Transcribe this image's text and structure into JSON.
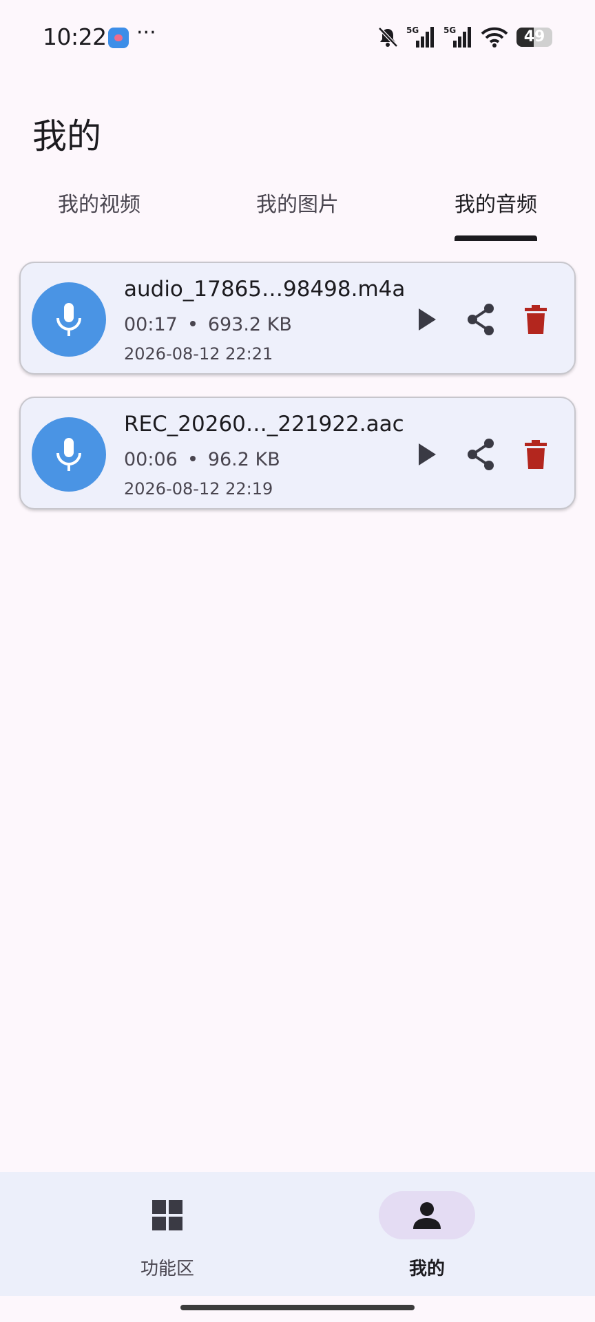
{
  "status_bar": {
    "time": "10:22",
    "dots": "···",
    "battery_level": "49",
    "icons": [
      "notifications-off-icon",
      "signal-5g-icon",
      "signal-5g-icon",
      "wifi-icon",
      "battery-icon"
    ]
  },
  "page": {
    "title": "我的"
  },
  "tabs": [
    {
      "label": "我的视频",
      "active": false
    },
    {
      "label": "我的图片",
      "active": false
    },
    {
      "label": "我的音频",
      "active": true
    }
  ],
  "audio_items": [
    {
      "name": "audio_17865…98498.m4a",
      "duration": "00:17",
      "size": "693.2 KB",
      "date": "2026-08-12 22:21"
    },
    {
      "name": "REC_20260…_221922.aac",
      "duration": "00:06",
      "size": "96.2 KB",
      "date": "2026-08-12 22:19"
    }
  ],
  "bottom_nav": [
    {
      "label": "功能区",
      "icon": "grid-icon",
      "selected": false
    },
    {
      "label": "我的",
      "icon": "person-icon",
      "selected": true
    }
  ],
  "colors": {
    "background": "#fdf7fc",
    "accent_blue": "#4a94e4",
    "delete_red": "#b3261e",
    "card_bg": "#eef0fb",
    "nav_bg": "#eceffa",
    "nav_selected_pill": "#e4dcf3"
  }
}
